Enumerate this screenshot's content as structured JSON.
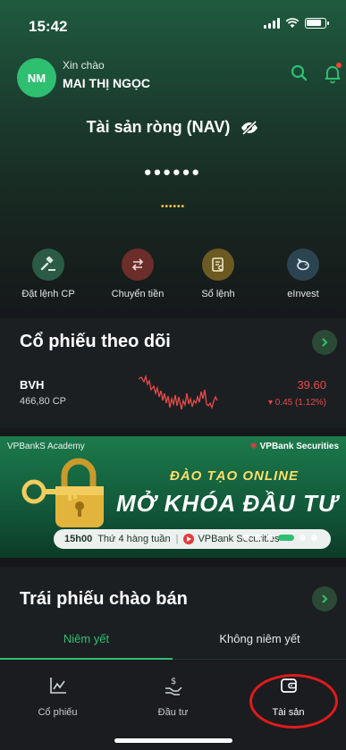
{
  "status_bar": {
    "time": "15:42"
  },
  "header": {
    "avatar_initials": "NM",
    "greeting": "Xin chào",
    "username": "MAI THỊ NGỌC"
  },
  "nav": {
    "title": "Tài sản ròng (NAV)",
    "value": "••••••",
    "sub_value": "••••••"
  },
  "quick_actions": [
    {
      "label": "Đặt lệnh CP",
      "icon": "gavel-icon",
      "color": "#2b5b44"
    },
    {
      "label": "Chuyển tiền",
      "icon": "transfer-icon",
      "color": "#6b2e2a"
    },
    {
      "label": "Sổ lệnh",
      "icon": "order-book-icon",
      "color": "#6d5a23"
    },
    {
      "label": "eInvest",
      "icon": "piggy-bank-icon",
      "color": "#2c4452"
    }
  ],
  "watchlist": {
    "title": "Cổ phiếu theo dõi",
    "stock": {
      "code": "BVH",
      "volume": "466,80 CP",
      "price": "39.60",
      "change": "▾ 0.45 (1.12%)"
    }
  },
  "banner": {
    "academy": "VPBankS Academy",
    "brand": "VPBank Securities",
    "line1": "ĐÀO TẠO ONLINE",
    "line2": "MỞ KHÓA ĐẦU TƯ",
    "time": "15h00",
    "schedule": "Thứ 4 hàng tuần",
    "channel": "VPBank Securities"
  },
  "bonds": {
    "title": "Trái phiếu chào bán",
    "tabs": [
      "Niêm yết",
      "Không niêm yết"
    ]
  },
  "bottom_nav": [
    {
      "label": "Cổ phiếu",
      "icon": "chart-icon"
    },
    {
      "label": "Đầu tư",
      "icon": "invest-icon"
    },
    {
      "label": "Tài sản",
      "icon": "wallet-icon"
    }
  ],
  "colors": {
    "accent": "#2fbf71",
    "down": "#e84a4a",
    "highlight": "#e01b1b"
  }
}
